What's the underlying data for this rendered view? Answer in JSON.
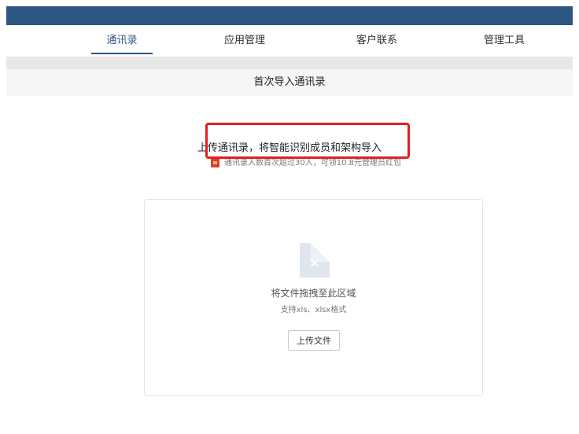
{
  "nav": {
    "tabs": [
      {
        "label": "通讯录",
        "active": true
      },
      {
        "label": "应用管理",
        "active": false
      },
      {
        "label": "客户联系",
        "active": false
      },
      {
        "label": "管理工具",
        "active": false
      }
    ]
  },
  "page": {
    "title": "首次导入通讯录"
  },
  "intro": {
    "headline": "上传通讯录，将智能识别成员和架构导入",
    "notice": "通讯录人数首次超过30人，可领10.8元管理员红包"
  },
  "dropzone": {
    "file_icon": "x-file-icon",
    "drag_text": "将文件拖拽至此区域",
    "formats_text": "支持xls、xlsx格式",
    "upload_button": "上传文件"
  },
  "colors": {
    "topbar": "#2f5582",
    "active_tab": "#2f5582",
    "highlight": "#e02020"
  }
}
